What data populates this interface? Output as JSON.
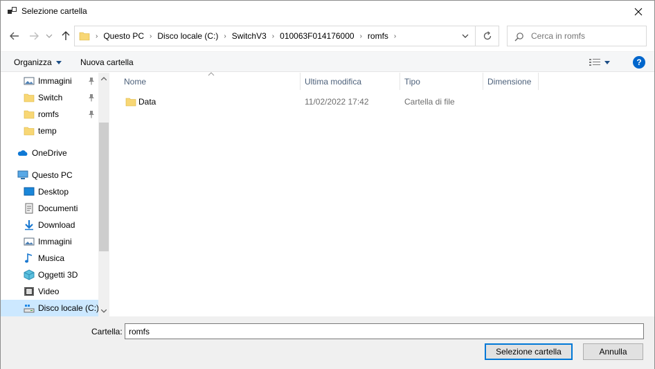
{
  "window": {
    "title": "Selezione cartella",
    "title_icon": "app-window-icon",
    "close_icon": "close-icon"
  },
  "navigation": {
    "back_icon": "back-arrow-icon",
    "forward_icon": "forward-arrow-icon",
    "recent_icon": "chevron-down-icon",
    "up_icon": "up-arrow-icon",
    "breadcrumbs": [
      "Questo PC",
      "Disco locale (C:)",
      "SwitchV3",
      "010063F014176000",
      "romfs"
    ],
    "refresh_icon": "refresh-icon",
    "search": {
      "placeholder": "Cerca in romfs"
    }
  },
  "toolbar": {
    "organize_label": "Organizza",
    "new_folder_label": "Nuova cartella",
    "view_icon": "view-details-icon",
    "help_label": "?"
  },
  "sidebar": {
    "items": [
      {
        "label": "Immagini",
        "icon": "pictures-icon",
        "pinned": true
      },
      {
        "label": "Switch",
        "icon": "folder-icon",
        "pinned": true
      },
      {
        "label": "romfs",
        "icon": "folder-icon",
        "pinned": true
      },
      {
        "label": "temp",
        "icon": "folder-icon",
        "pinned": false
      },
      {
        "label": "OneDrive",
        "icon": "onedrive-icon",
        "pinned": false
      },
      {
        "label": "Questo PC",
        "icon": "computer-icon",
        "pinned": false
      },
      {
        "label": "Desktop",
        "icon": "desktop-icon",
        "pinned": false
      },
      {
        "label": "Documenti",
        "icon": "documents-icon",
        "pinned": false
      },
      {
        "label": "Download",
        "icon": "download-icon",
        "pinned": false
      },
      {
        "label": "Immagini",
        "icon": "pictures-icon",
        "pinned": false
      },
      {
        "label": "Musica",
        "icon": "music-icon",
        "pinned": false
      },
      {
        "label": "Oggetti 3D",
        "icon": "objects-3d-icon",
        "pinned": false
      },
      {
        "label": "Video",
        "icon": "video-icon",
        "pinned": false
      },
      {
        "label": "Disco locale (C:)",
        "icon": "drive-icon",
        "pinned": false,
        "selected": true
      }
    ]
  },
  "file_list": {
    "columns": [
      "Nome",
      "Ultima modifica",
      "Tipo",
      "Dimensione"
    ],
    "rows": [
      {
        "name": "Data",
        "modified": "11/02/2022 17:42",
        "type": "Cartella di file",
        "size": ""
      }
    ]
  },
  "footer": {
    "folder_label": "Cartella:",
    "folder_value": "romfs",
    "select_button": "Selezione cartella",
    "cancel_button": "Annulla"
  },
  "colors": {
    "accent": "#0078d7",
    "selection": "#cce8ff",
    "folder": "#f8d775",
    "help": "#0066cc"
  }
}
